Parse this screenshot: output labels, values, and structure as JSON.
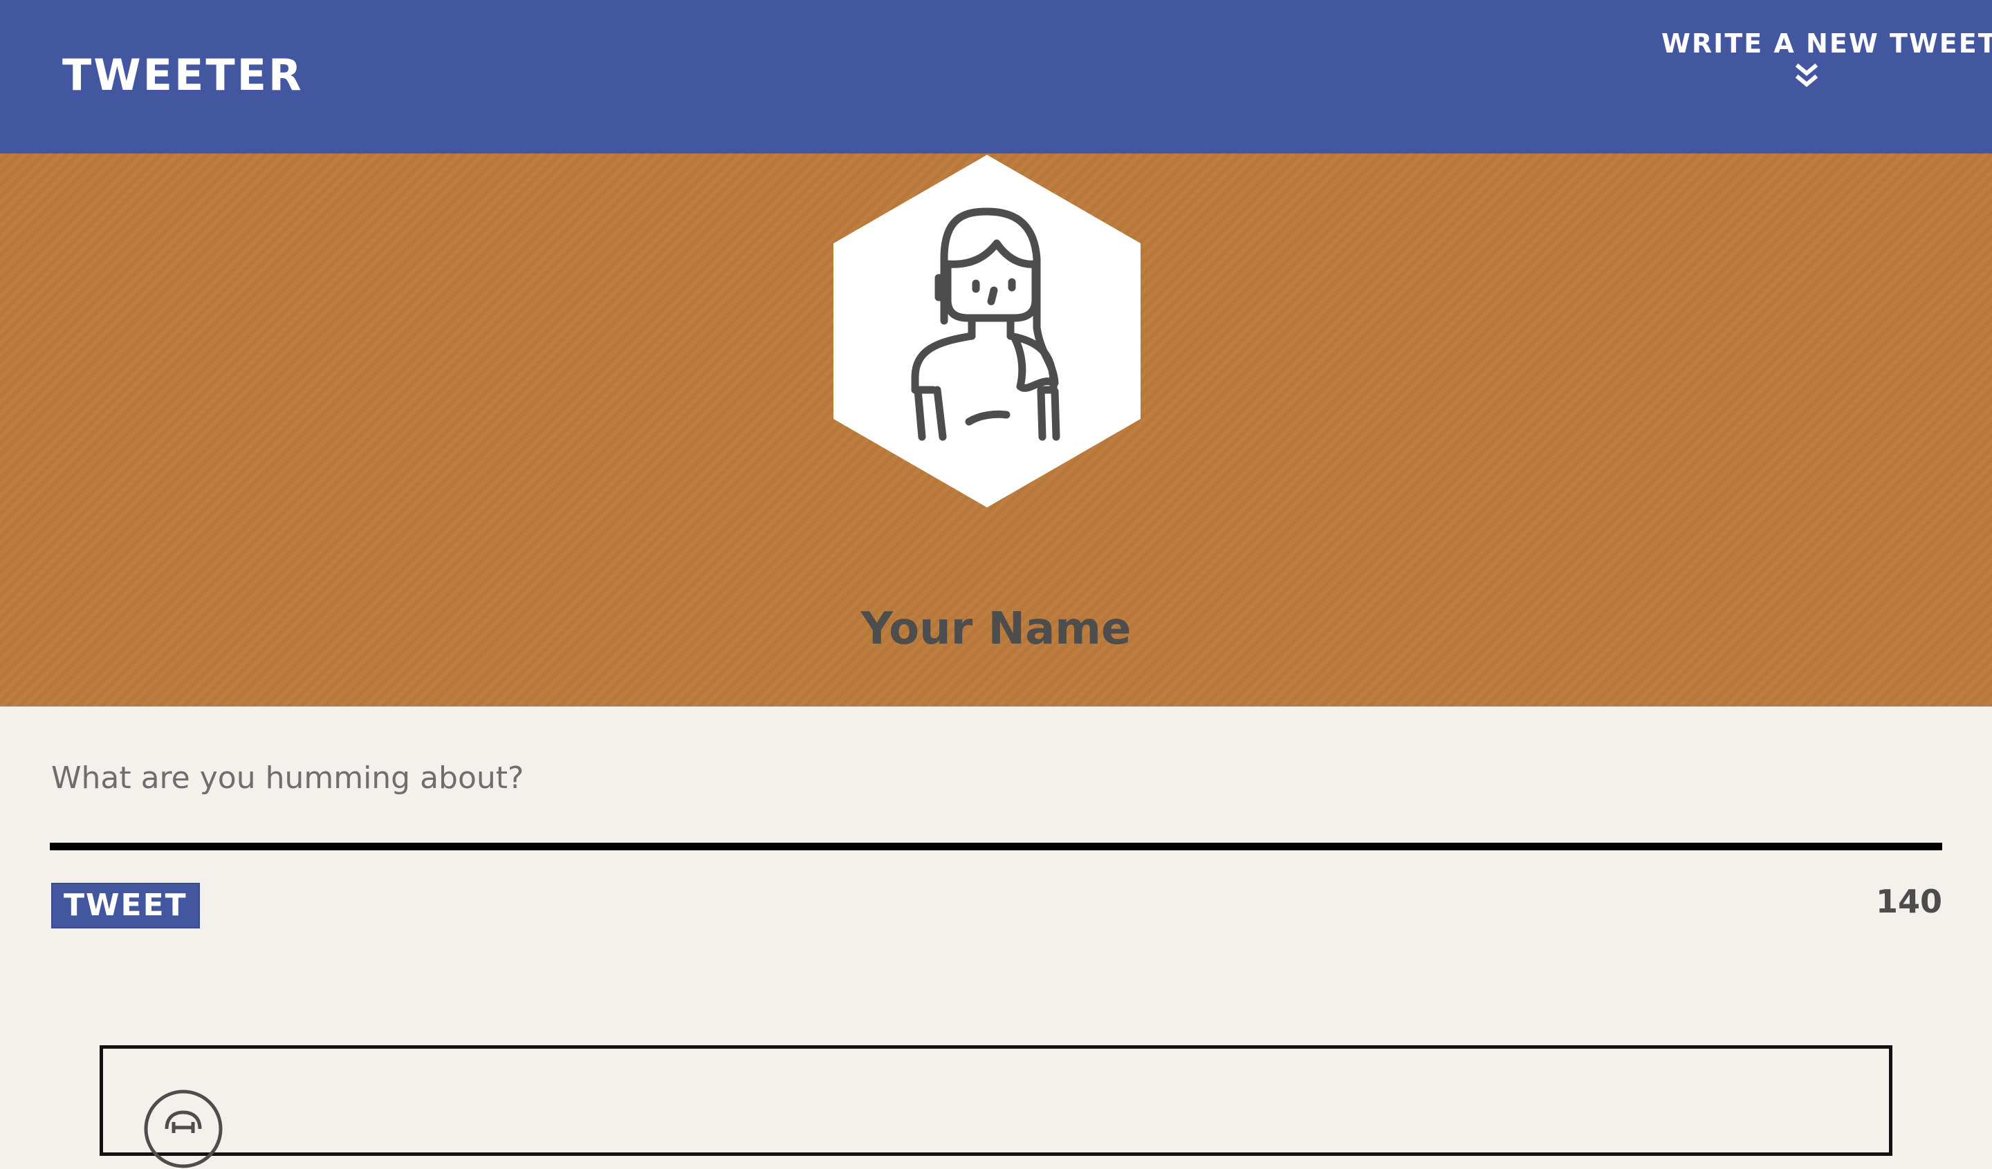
{
  "nav": {
    "brand": "TWEETER",
    "compose_label": "WRITE A NEW TWEET",
    "compose_icon": "double-chevron-down-icon"
  },
  "profile": {
    "avatar_icon": "woman-avatar-icon",
    "name": "Your Name",
    "background_color": "#bb7b3b"
  },
  "composer": {
    "placeholder": "What are you humming about?",
    "value": "",
    "submit_label": "TWEET",
    "char_count": "140"
  },
  "tweet_card": {
    "avatar_icon": "user-avatar-icon"
  },
  "colors": {
    "nav": "#4356a0",
    "accent": "#4356a0",
    "page_background": "#f4f1ec",
    "name_text": "#4d4d4d"
  }
}
